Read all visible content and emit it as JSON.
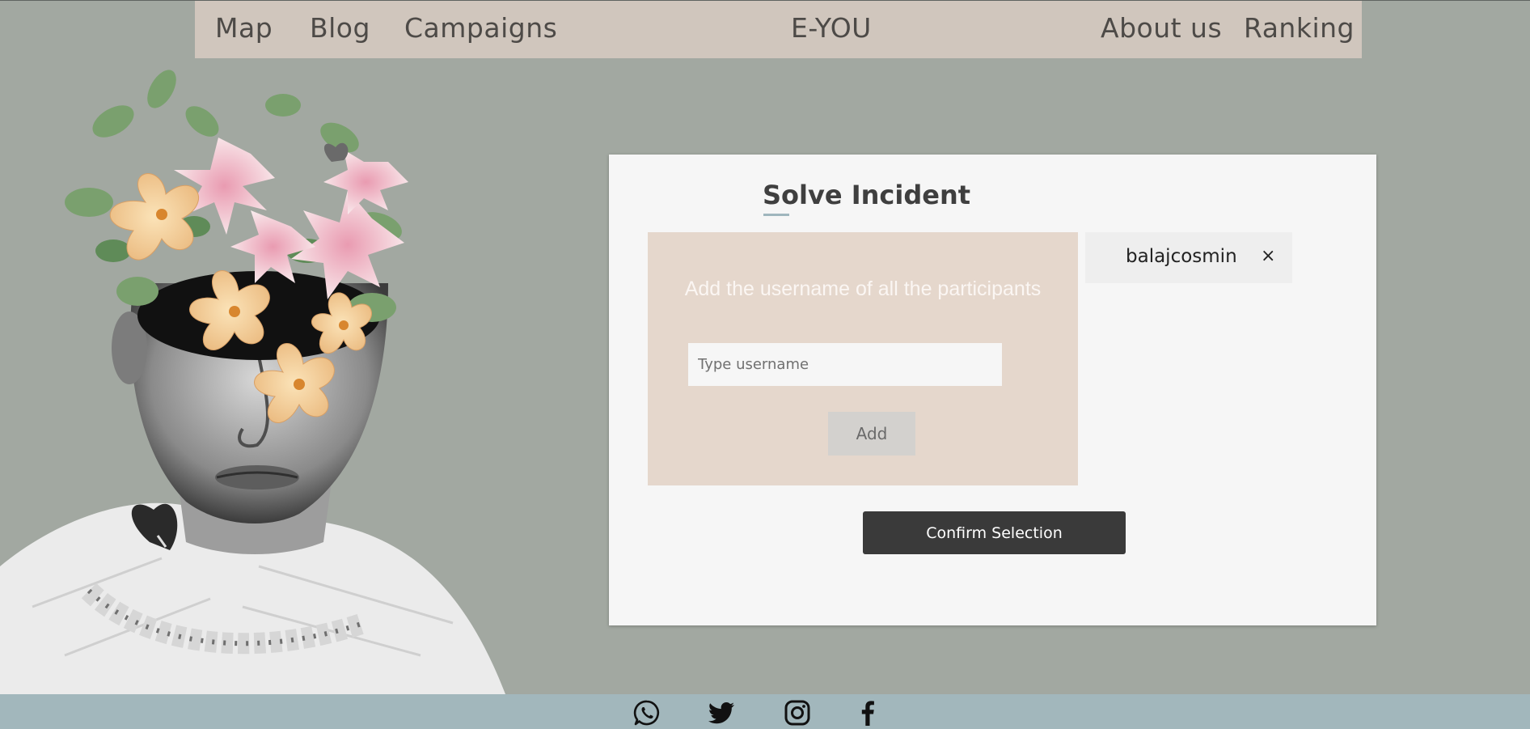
{
  "nav": {
    "left": [
      "Map",
      "Blog",
      "Campaigns"
    ],
    "brand": "E-YOU",
    "right": [
      "About us",
      "Ranking"
    ]
  },
  "incident": {
    "title": "Solve Incident",
    "hint": "Add the username of all the participants",
    "input_placeholder": "Type username",
    "input_value": "",
    "add_label": "Add",
    "participants": [
      "balajcosmin"
    ],
    "remove_symbol": "×",
    "confirm_label": "Confirm Selection"
  },
  "footer": {
    "social_icons": [
      "whatsapp-icon",
      "twitter-icon",
      "instagram-icon",
      "facebook-icon"
    ]
  },
  "colors": {
    "background": "#a2a8a1",
    "navbar": "#d0c6bd",
    "panel": "#e5d7cc",
    "confirm": "#3a3a3a",
    "footer": "#a2b7bc"
  }
}
